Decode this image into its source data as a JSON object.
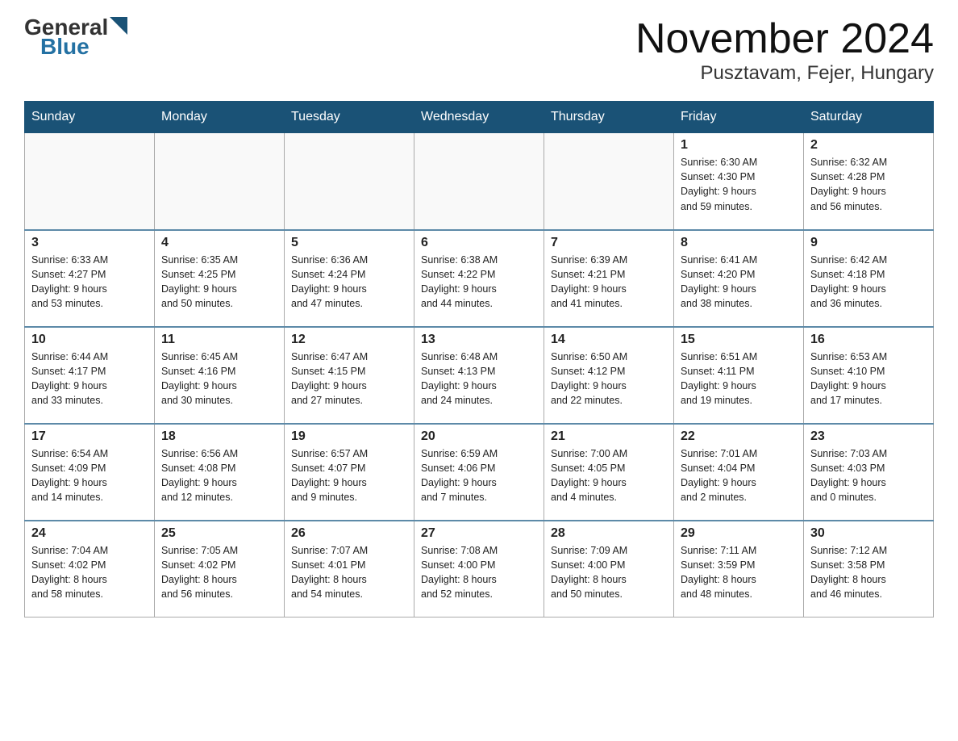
{
  "header": {
    "logo_general": "General",
    "logo_blue": "Blue",
    "title": "November 2024",
    "subtitle": "Pusztavam, Fejer, Hungary"
  },
  "weekdays": [
    "Sunday",
    "Monday",
    "Tuesday",
    "Wednesday",
    "Thursday",
    "Friday",
    "Saturday"
  ],
  "weeks": [
    [
      {
        "day": "",
        "info": ""
      },
      {
        "day": "",
        "info": ""
      },
      {
        "day": "",
        "info": ""
      },
      {
        "day": "",
        "info": ""
      },
      {
        "day": "",
        "info": ""
      },
      {
        "day": "1",
        "info": "Sunrise: 6:30 AM\nSunset: 4:30 PM\nDaylight: 9 hours\nand 59 minutes."
      },
      {
        "day": "2",
        "info": "Sunrise: 6:32 AM\nSunset: 4:28 PM\nDaylight: 9 hours\nand 56 minutes."
      }
    ],
    [
      {
        "day": "3",
        "info": "Sunrise: 6:33 AM\nSunset: 4:27 PM\nDaylight: 9 hours\nand 53 minutes."
      },
      {
        "day": "4",
        "info": "Sunrise: 6:35 AM\nSunset: 4:25 PM\nDaylight: 9 hours\nand 50 minutes."
      },
      {
        "day": "5",
        "info": "Sunrise: 6:36 AM\nSunset: 4:24 PM\nDaylight: 9 hours\nand 47 minutes."
      },
      {
        "day": "6",
        "info": "Sunrise: 6:38 AM\nSunset: 4:22 PM\nDaylight: 9 hours\nand 44 minutes."
      },
      {
        "day": "7",
        "info": "Sunrise: 6:39 AM\nSunset: 4:21 PM\nDaylight: 9 hours\nand 41 minutes."
      },
      {
        "day": "8",
        "info": "Sunrise: 6:41 AM\nSunset: 4:20 PM\nDaylight: 9 hours\nand 38 minutes."
      },
      {
        "day": "9",
        "info": "Sunrise: 6:42 AM\nSunset: 4:18 PM\nDaylight: 9 hours\nand 36 minutes."
      }
    ],
    [
      {
        "day": "10",
        "info": "Sunrise: 6:44 AM\nSunset: 4:17 PM\nDaylight: 9 hours\nand 33 minutes."
      },
      {
        "day": "11",
        "info": "Sunrise: 6:45 AM\nSunset: 4:16 PM\nDaylight: 9 hours\nand 30 minutes."
      },
      {
        "day": "12",
        "info": "Sunrise: 6:47 AM\nSunset: 4:15 PM\nDaylight: 9 hours\nand 27 minutes."
      },
      {
        "day": "13",
        "info": "Sunrise: 6:48 AM\nSunset: 4:13 PM\nDaylight: 9 hours\nand 24 minutes."
      },
      {
        "day": "14",
        "info": "Sunrise: 6:50 AM\nSunset: 4:12 PM\nDaylight: 9 hours\nand 22 minutes."
      },
      {
        "day": "15",
        "info": "Sunrise: 6:51 AM\nSunset: 4:11 PM\nDaylight: 9 hours\nand 19 minutes."
      },
      {
        "day": "16",
        "info": "Sunrise: 6:53 AM\nSunset: 4:10 PM\nDaylight: 9 hours\nand 17 minutes."
      }
    ],
    [
      {
        "day": "17",
        "info": "Sunrise: 6:54 AM\nSunset: 4:09 PM\nDaylight: 9 hours\nand 14 minutes."
      },
      {
        "day": "18",
        "info": "Sunrise: 6:56 AM\nSunset: 4:08 PM\nDaylight: 9 hours\nand 12 minutes."
      },
      {
        "day": "19",
        "info": "Sunrise: 6:57 AM\nSunset: 4:07 PM\nDaylight: 9 hours\nand 9 minutes."
      },
      {
        "day": "20",
        "info": "Sunrise: 6:59 AM\nSunset: 4:06 PM\nDaylight: 9 hours\nand 7 minutes."
      },
      {
        "day": "21",
        "info": "Sunrise: 7:00 AM\nSunset: 4:05 PM\nDaylight: 9 hours\nand 4 minutes."
      },
      {
        "day": "22",
        "info": "Sunrise: 7:01 AM\nSunset: 4:04 PM\nDaylight: 9 hours\nand 2 minutes."
      },
      {
        "day": "23",
        "info": "Sunrise: 7:03 AM\nSunset: 4:03 PM\nDaylight: 9 hours\nand 0 minutes."
      }
    ],
    [
      {
        "day": "24",
        "info": "Sunrise: 7:04 AM\nSunset: 4:02 PM\nDaylight: 8 hours\nand 58 minutes."
      },
      {
        "day": "25",
        "info": "Sunrise: 7:05 AM\nSunset: 4:02 PM\nDaylight: 8 hours\nand 56 minutes."
      },
      {
        "day": "26",
        "info": "Sunrise: 7:07 AM\nSunset: 4:01 PM\nDaylight: 8 hours\nand 54 minutes."
      },
      {
        "day": "27",
        "info": "Sunrise: 7:08 AM\nSunset: 4:00 PM\nDaylight: 8 hours\nand 52 minutes."
      },
      {
        "day": "28",
        "info": "Sunrise: 7:09 AM\nSunset: 4:00 PM\nDaylight: 8 hours\nand 50 minutes."
      },
      {
        "day": "29",
        "info": "Sunrise: 7:11 AM\nSunset: 3:59 PM\nDaylight: 8 hours\nand 48 minutes."
      },
      {
        "day": "30",
        "info": "Sunrise: 7:12 AM\nSunset: 3:58 PM\nDaylight: 8 hours\nand 46 minutes."
      }
    ]
  ]
}
